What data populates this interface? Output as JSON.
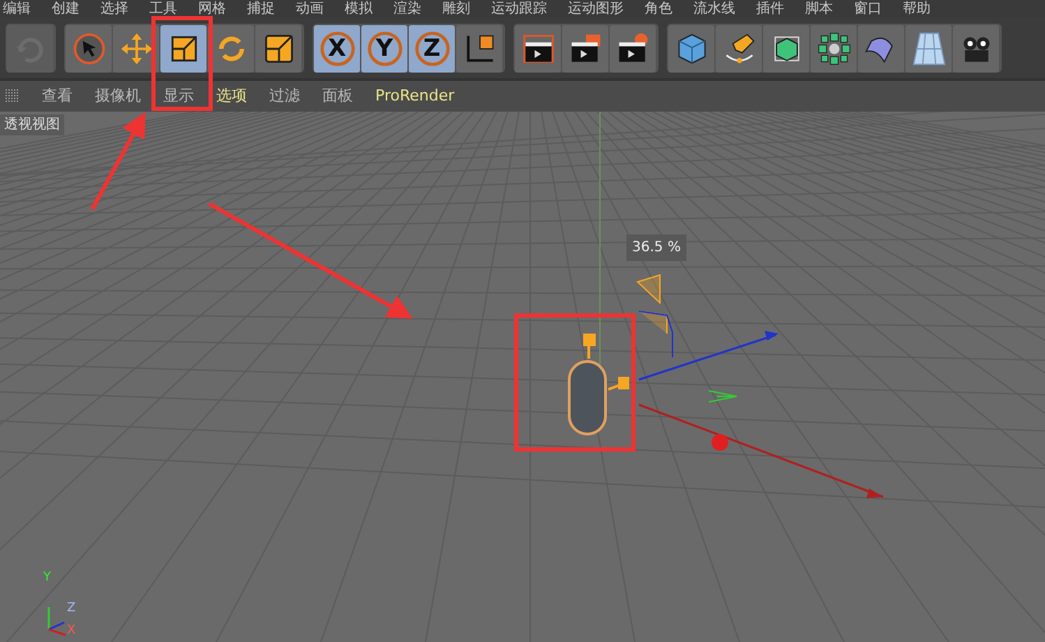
{
  "menu_bar": [
    "编辑",
    "创建",
    "选择",
    "工具",
    "网格",
    "捕捉",
    "动画",
    "模拟",
    "渲染",
    "雕刻",
    "运动跟踪",
    "运动图形",
    "角色",
    "流水线",
    "插件",
    "脚本",
    "窗口",
    "帮助"
  ],
  "toolbar": [
    [
      {
        "kind": "undo",
        "disabled": true,
        "selected": false
      }
    ],
    [
      {
        "kind": "select",
        "disabled": false,
        "selected": false
      },
      {
        "kind": "move",
        "disabled": false,
        "selected": false
      },
      {
        "kind": "scale",
        "disabled": false,
        "selected": true
      },
      {
        "kind": "rotate",
        "disabled": false,
        "selected": false
      },
      {
        "kind": "box",
        "disabled": false,
        "selected": false
      }
    ],
    [
      {
        "kind": "axis",
        "label": "X",
        "disabled": false,
        "selected": true
      },
      {
        "kind": "axis",
        "label": "Y",
        "disabled": false,
        "selected": true
      },
      {
        "kind": "axis",
        "label": "Z",
        "disabled": false,
        "selected": true
      },
      {
        "kind": "coords",
        "disabled": false,
        "selected": false
      }
    ],
    [
      {
        "kind": "clapper",
        "disabled": false,
        "selected": false
      },
      {
        "kind": "clapper-window",
        "disabled": false,
        "selected": false
      },
      {
        "kind": "clapper-gear",
        "disabled": false,
        "selected": false
      }
    ],
    [
      {
        "kind": "cube",
        "disabled": false,
        "selected": false
      },
      {
        "kind": "pen",
        "disabled": false,
        "selected": false
      },
      {
        "kind": "subdivision",
        "disabled": false,
        "selected": false
      },
      {
        "kind": "cloner",
        "disabled": false,
        "selected": false
      },
      {
        "kind": "deformer",
        "disabled": false,
        "selected": false
      },
      {
        "kind": "floor",
        "disabled": false,
        "selected": false
      },
      {
        "kind": "camera",
        "disabled": false,
        "selected": false
      }
    ]
  ],
  "viewport_menu": [
    {
      "label": "查看",
      "selected": false
    },
    {
      "label": "摄像机",
      "selected": false
    },
    {
      "label": "显示",
      "selected": false
    },
    {
      "label": "选项",
      "selected": true
    },
    {
      "label": "过滤",
      "selected": false
    },
    {
      "label": "面板",
      "selected": false
    },
    {
      "label": "ProRender",
      "selected": true
    }
  ],
  "viewport": {
    "title": "透视视图",
    "scale_readout": "36.5 %",
    "axes": [
      "Y",
      "Z",
      "X"
    ]
  }
}
